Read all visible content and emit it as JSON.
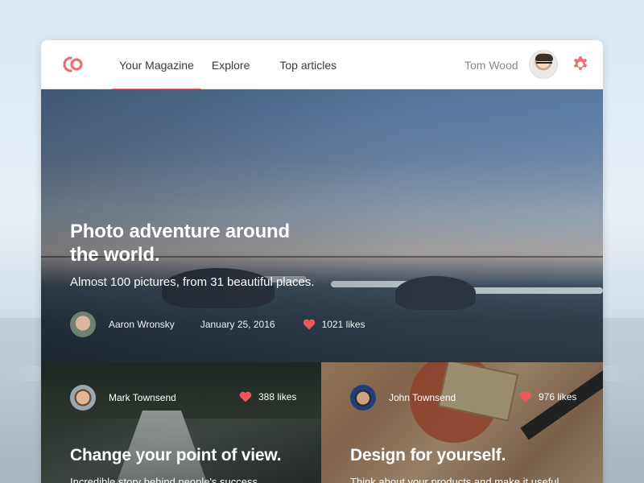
{
  "colors": {
    "accent": "#ec6f74",
    "heart": "#f0575d",
    "nav_text": "#3b3b3b"
  },
  "nav": {
    "logo_icon": "co-logo-icon",
    "tabs": [
      {
        "label": "Your Magazine",
        "active": true
      },
      {
        "label": "Explore",
        "active": false
      },
      {
        "label": "Top articles",
        "active": false
      }
    ],
    "user_name": "Tom Wood",
    "settings_icon": "gear-icon"
  },
  "featured": {
    "title": "Photo adventure around the world.",
    "subtitle": "Almost 100 pictures, from 31 beautiful places.",
    "author": "Aaron Wronsky",
    "date": "January 25, 2016",
    "likes": "1021 likes"
  },
  "cards": [
    {
      "author": "Mark Townsend",
      "likes": "388 likes",
      "title": "Change your point of view.",
      "subtitle": "Incredible story behind people's success"
    },
    {
      "author": "John Townsend",
      "likes": "976 likes",
      "title": "Design for yourself.",
      "subtitle": "Think about your products and make it useful"
    }
  ]
}
